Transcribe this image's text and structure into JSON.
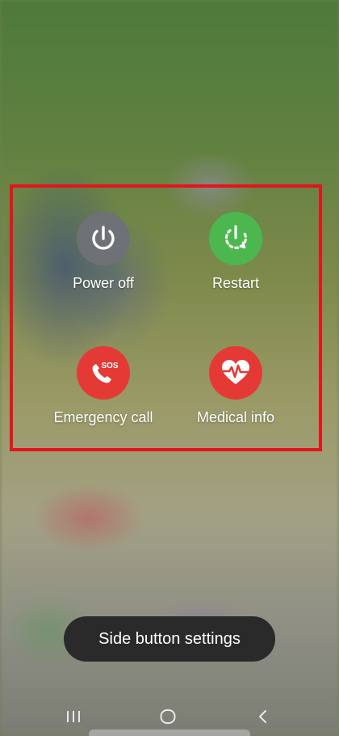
{
  "power_menu": {
    "items": [
      {
        "id": "power_off",
        "label": "Power off",
        "icon": "power-icon",
        "color": "#6e7276"
      },
      {
        "id": "restart",
        "label": "Restart",
        "icon": "restart-icon",
        "color": "#4cb74e"
      },
      {
        "id": "emergency_call",
        "label": "Emergency call",
        "icon": "sos-phone-icon",
        "icon_text": "SOS",
        "color": "#e53935"
      },
      {
        "id": "medical_info",
        "label": "Medical info",
        "icon": "heart-pulse-icon",
        "color": "#e53935"
      }
    ]
  },
  "side_button_settings": {
    "label": "Side button settings"
  },
  "highlight_color": "#e5141c",
  "navbar": {
    "buttons": [
      {
        "icon": "recent-apps-icon"
      },
      {
        "icon": "home-icon"
      },
      {
        "icon": "back-icon"
      }
    ]
  }
}
